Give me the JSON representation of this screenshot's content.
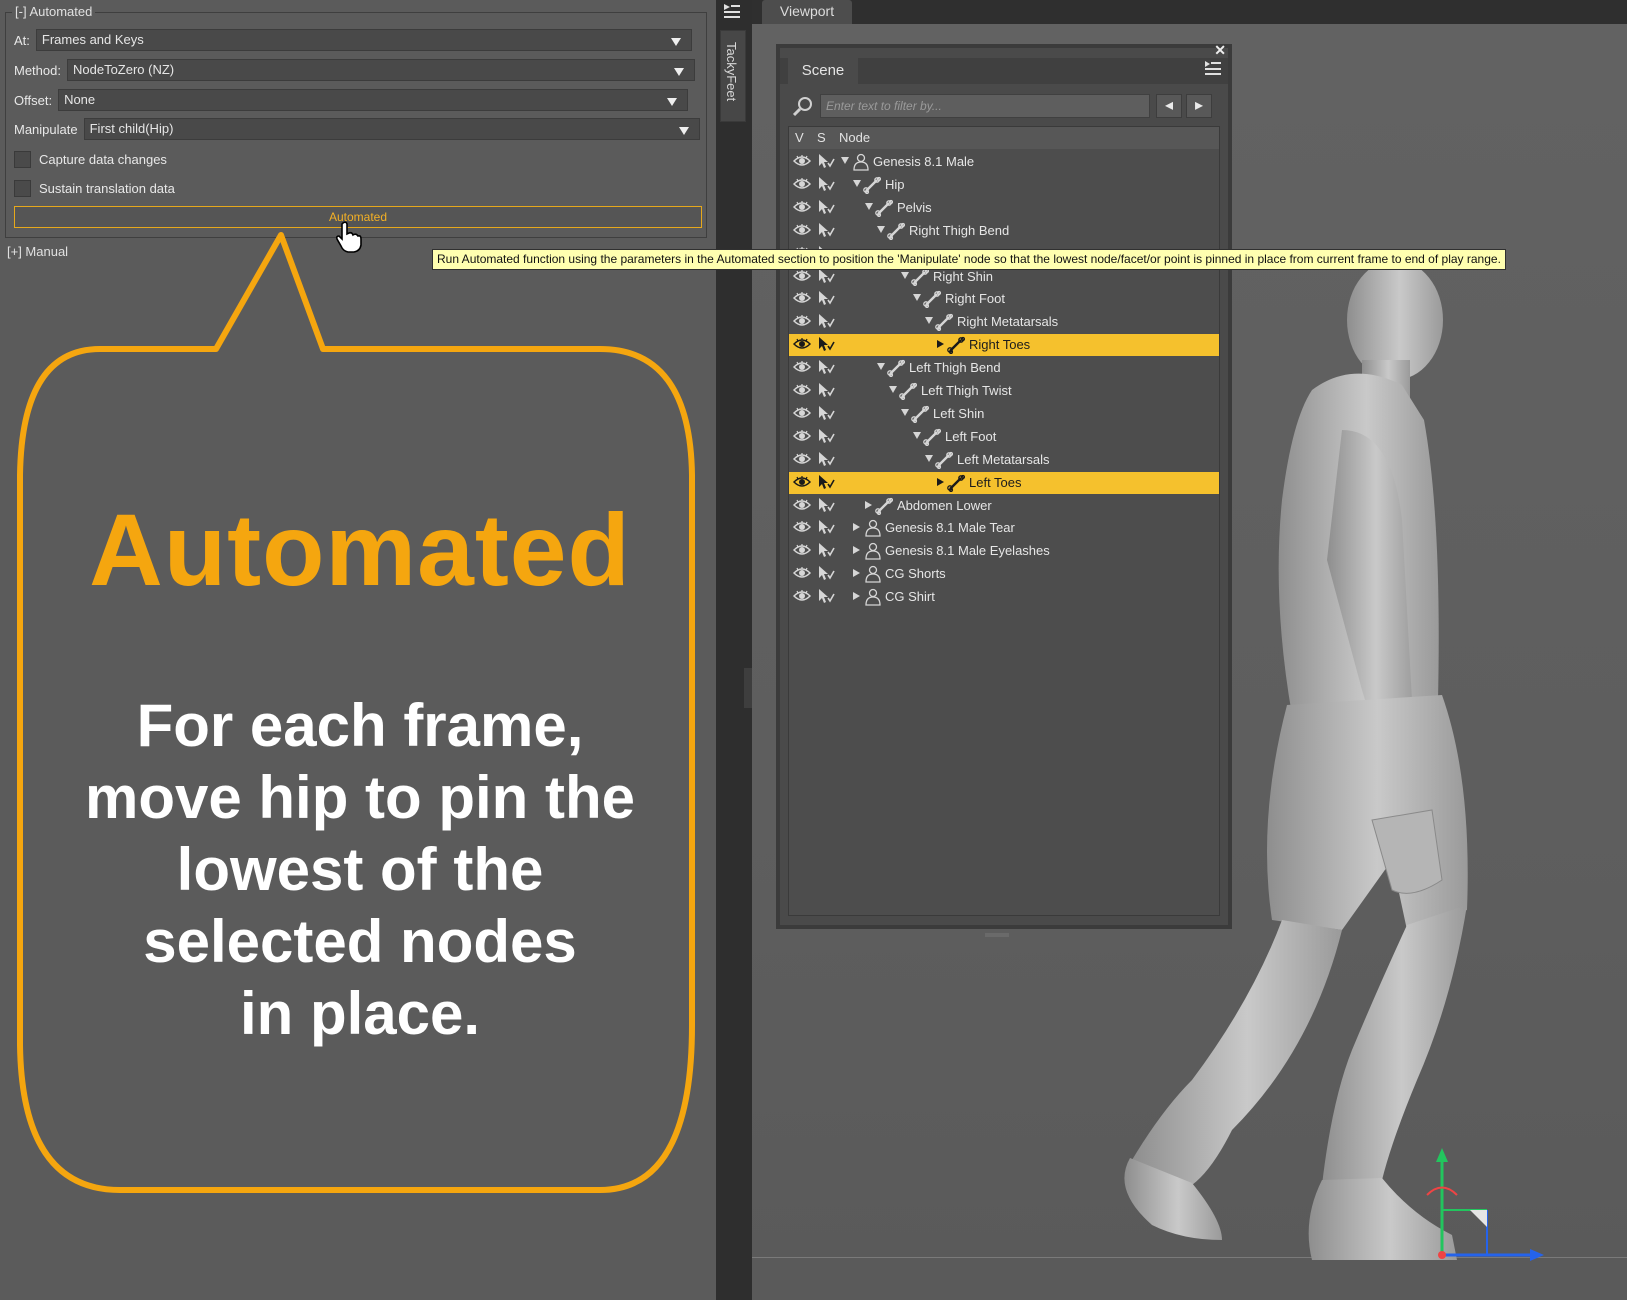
{
  "automated_section": {
    "title": "[-] Automated",
    "at_label": "At:",
    "at_value": "Frames and Keys",
    "method_label": "Method:",
    "method_value": "NodeToZero (NZ)",
    "offset_label": "Offset:",
    "offset_value": "None",
    "manipulate_label": "Manipulate",
    "manipulate_value": "First child(Hip)",
    "capture_label": "Capture data changes",
    "capture_checked": false,
    "sustain_label": "Sustain translation data",
    "sustain_checked": false,
    "button_label": "Automated"
  },
  "manual_section": {
    "title": "[+] Manual"
  },
  "callout": {
    "title": "Automated",
    "body": "For each frame,\nmove hip to pin the\nlowest of the\nselected nodes\nin place.",
    "accent_color": "#f5a60f"
  },
  "side_tab": {
    "label": "TackyFeet"
  },
  "viewport": {
    "tab_label": "Viewport"
  },
  "scene": {
    "tab_label": "Scene",
    "filter_placeholder": "Enter text to filter by...",
    "columns": {
      "v": "V",
      "s": "S",
      "node": "Node"
    },
    "nodes": [
      {
        "label": "Genesis 8.1 Male",
        "depth": 0,
        "type": "figure",
        "expanded": true,
        "selected": false
      },
      {
        "label": "Hip",
        "depth": 1,
        "type": "bone",
        "expanded": true,
        "selected": false
      },
      {
        "label": "Pelvis",
        "depth": 2,
        "type": "bone",
        "expanded": true,
        "selected": false
      },
      {
        "label": "Right Thigh Bend",
        "depth": 3,
        "type": "bone",
        "expanded": true,
        "selected": false
      },
      {
        "label": "",
        "depth": 4,
        "type": "hidden",
        "expanded": true,
        "selected": false
      },
      {
        "label": "Right Shin",
        "depth": 5,
        "type": "bone",
        "expanded": true,
        "selected": false
      },
      {
        "label": "Right Foot",
        "depth": 6,
        "type": "bone",
        "expanded": true,
        "selected": false
      },
      {
        "label": "Right Metatarsals",
        "depth": 7,
        "type": "bone",
        "expanded": true,
        "selected": false
      },
      {
        "label": "Right Toes",
        "depth": 8,
        "type": "bone",
        "expanded": false,
        "selected": true
      },
      {
        "label": "Left Thigh Bend",
        "depth": 3,
        "type": "bone",
        "expanded": true,
        "selected": false
      },
      {
        "label": "Left Thigh Twist",
        "depth": 4,
        "type": "bone",
        "expanded": true,
        "selected": false
      },
      {
        "label": "Left Shin",
        "depth": 5,
        "type": "bone",
        "expanded": true,
        "selected": false
      },
      {
        "label": "Left Foot",
        "depth": 6,
        "type": "bone",
        "expanded": true,
        "selected": false
      },
      {
        "label": "Left Metatarsals",
        "depth": 7,
        "type": "bone",
        "expanded": true,
        "selected": false
      },
      {
        "label": "Left Toes",
        "depth": 8,
        "type": "bone",
        "expanded": false,
        "selected": true
      },
      {
        "label": "Abdomen Lower",
        "depth": 2,
        "type": "bone",
        "expanded": false,
        "selected": false
      },
      {
        "label": "Genesis 8.1 Male Tear",
        "depth": 1,
        "type": "figure",
        "expanded": false,
        "selected": false
      },
      {
        "label": "Genesis 8.1 Male Eyelashes",
        "depth": 1,
        "type": "figure",
        "expanded": false,
        "selected": false
      },
      {
        "label": "CG Shorts",
        "depth": 1,
        "type": "figure",
        "expanded": false,
        "selected": false
      },
      {
        "label": "CG Shirt",
        "depth": 1,
        "type": "figure",
        "expanded": false,
        "selected": false
      }
    ]
  },
  "tooltip": {
    "text": "Run Automated function using the parameters in the Automated section to position the 'Manipulate' node so that the lowest node/facet/or point is pinned in place from current frame to end of play range."
  },
  "icons": {
    "eye": "eye-icon",
    "select": "select-arrow-icon",
    "bone": "bone-icon",
    "figure": "figure-icon",
    "search": "search-icon",
    "pane_menu": "pane-menu-icon",
    "close": "close-icon",
    "hand_cursor": "hand-cursor-icon"
  }
}
